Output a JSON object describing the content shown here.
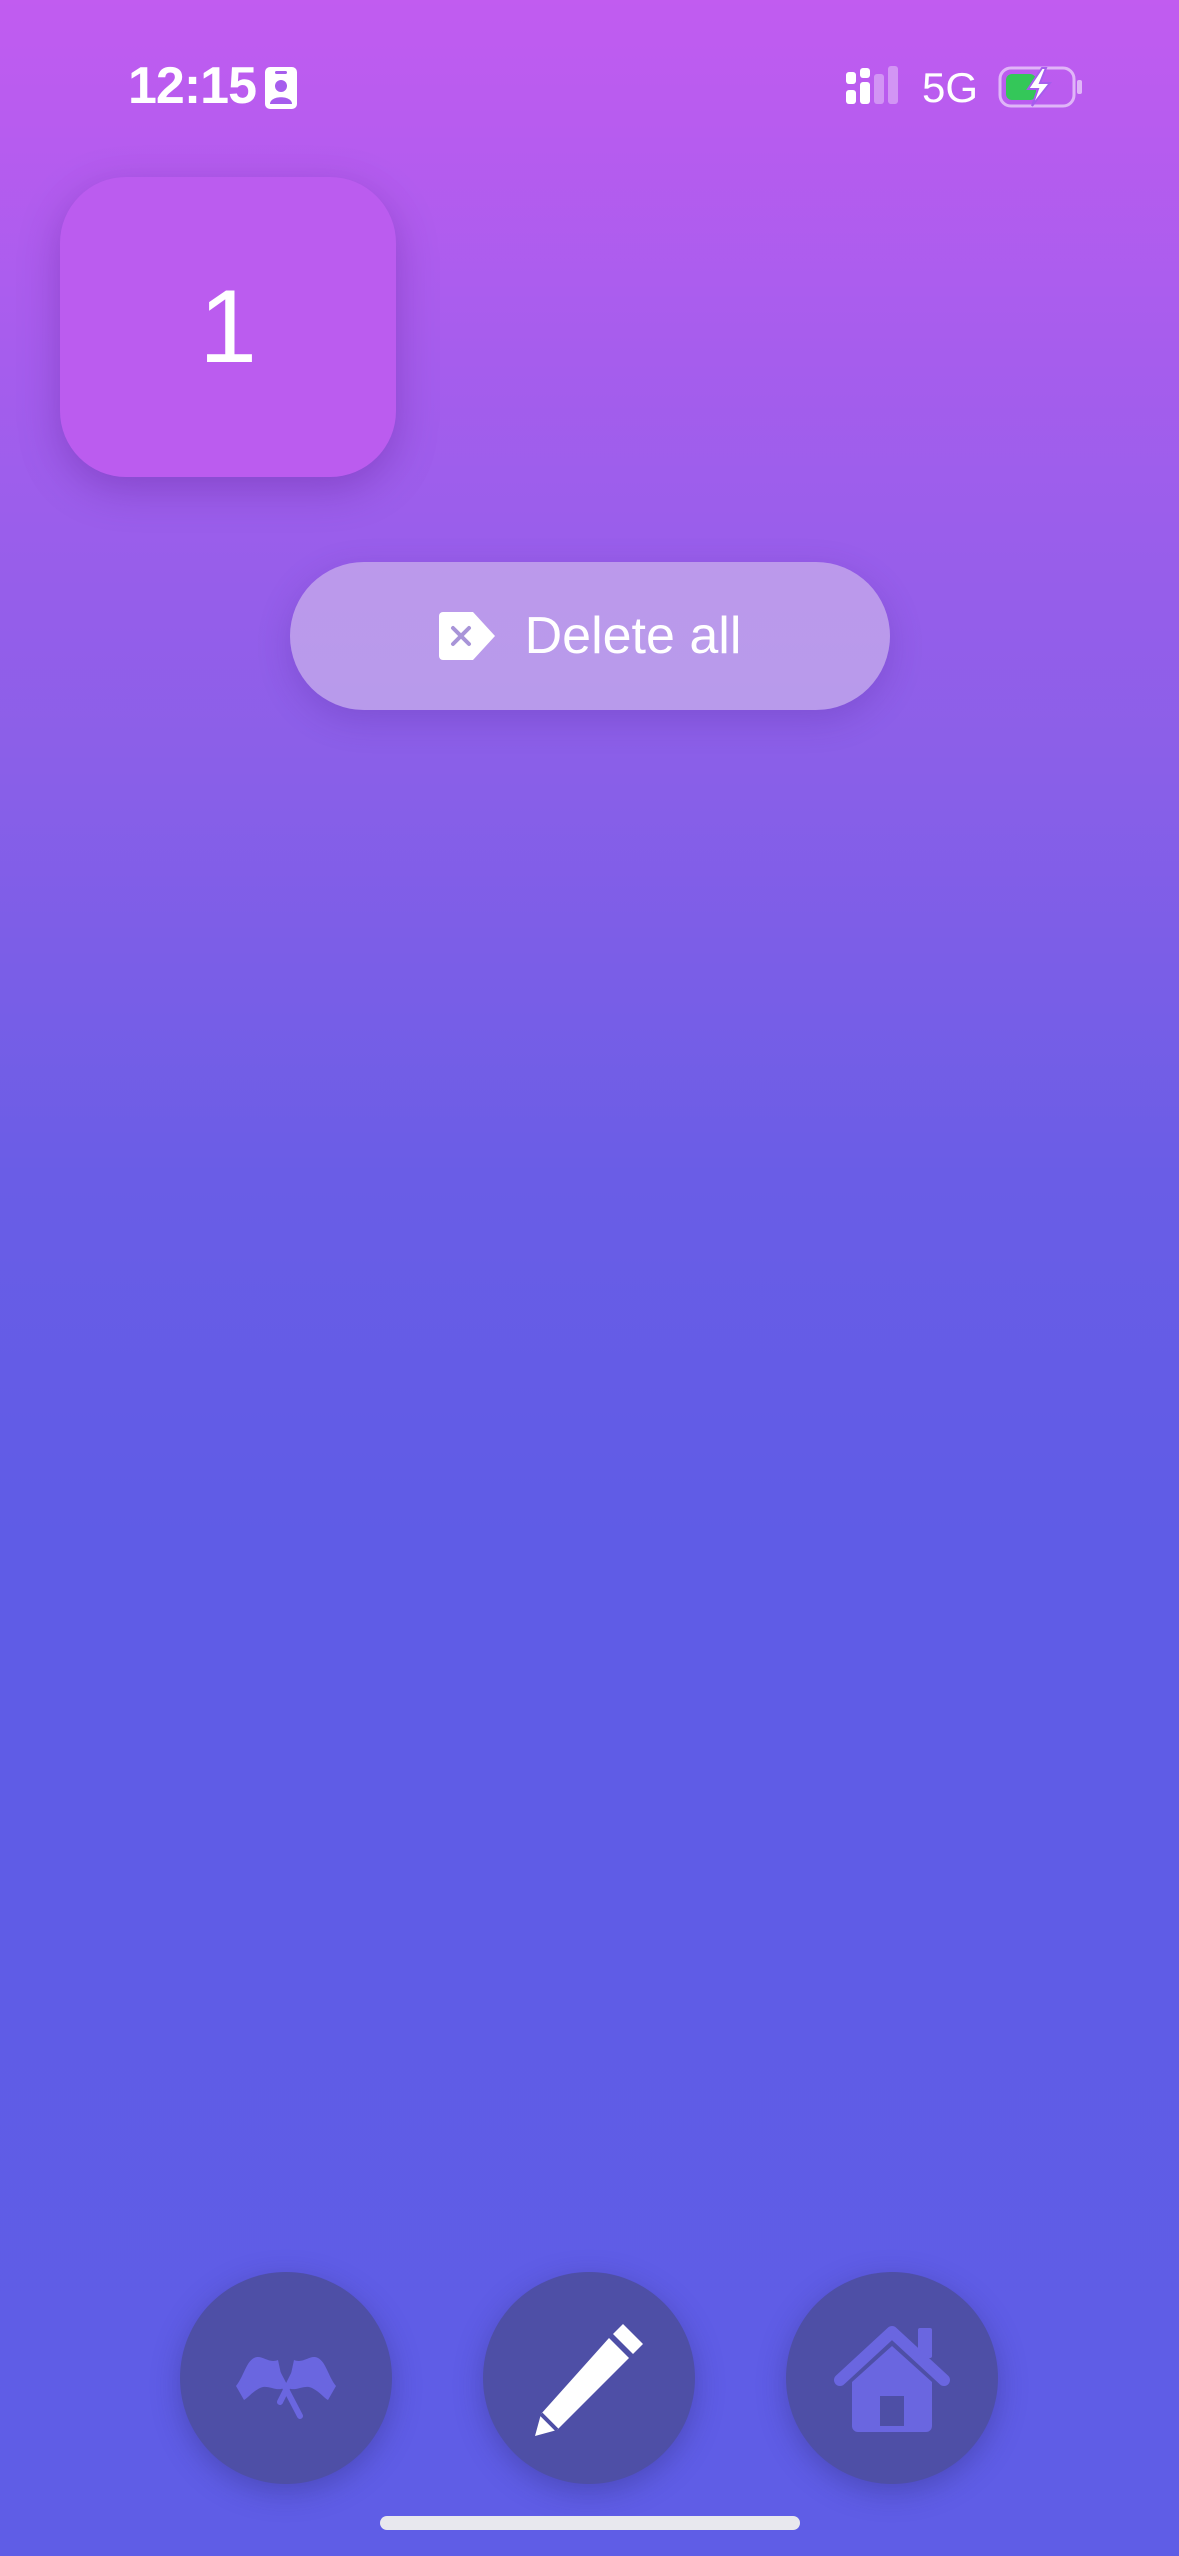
{
  "status_bar": {
    "time": "12:15",
    "network": "5G",
    "icons": [
      "contact-card-icon",
      "cellular-signal-icon",
      "battery-charging-icon"
    ],
    "battery_fill_color": "#34c759"
  },
  "counter": {
    "value": "1"
  },
  "actions": {
    "delete_all_label": "Delete all",
    "delete_all_icon": "tag-x-icon"
  },
  "toolbar": {
    "buttons": [
      {
        "name": "flags",
        "icon": "crossed-flags-icon"
      },
      {
        "name": "edit",
        "icon": "pencil-icon"
      },
      {
        "name": "home",
        "icon": "house-icon"
      }
    ]
  },
  "colors": {
    "background_top": "#c15cf0",
    "background_bottom": "#5f5de6",
    "tile": "#bb5cef",
    "toolbar_button": "#4e4fa6"
  }
}
